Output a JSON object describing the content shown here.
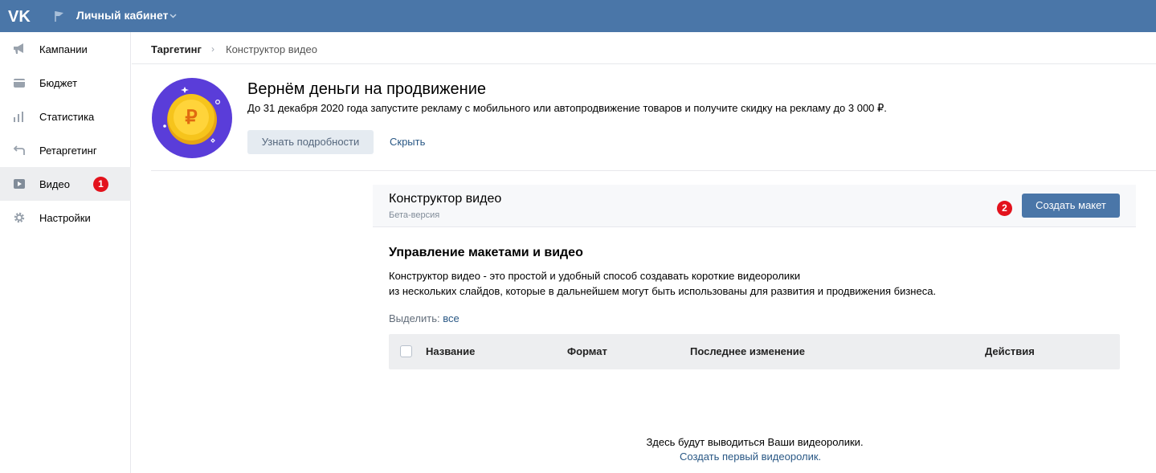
{
  "header": {
    "logo": "vk-logo",
    "title": "Личный кабинет"
  },
  "sidebar": {
    "items": [
      {
        "label": "Кампании",
        "icon": "megaphone-icon"
      },
      {
        "label": "Бюджет",
        "icon": "wallet-icon"
      },
      {
        "label": "Статистика",
        "icon": "bar-chart-icon"
      },
      {
        "label": "Ретаргетинг",
        "icon": "retarget-arrow-icon"
      },
      {
        "label": "Видео",
        "icon": "video-play-icon",
        "badge": "1",
        "active": true
      },
      {
        "label": "Настройки",
        "icon": "gear-icon"
      }
    ]
  },
  "breadcrumb": {
    "root": "Таргетинг",
    "separator": "›",
    "current": "Конструктор видео"
  },
  "promo": {
    "title": "Вернём деньги на продвижение",
    "text": "До 31 декабря 2020 года запустите рекламу с мобильного или автопродвижение товаров и получите скидку на рекламу до 3 000 ₽.",
    "details_button": "Узнать подробности",
    "hide_link": "Скрыть",
    "coin_symbol": "₽"
  },
  "panel": {
    "title": "Конструктор видео",
    "subtitle": "Бета-версия",
    "badge": "2",
    "create_button": "Создать макет"
  },
  "management": {
    "title": "Управление макетами и видео",
    "description_line1": "Конструктор видео - это простой и удобный способ создавать короткие видеоролики",
    "description_line2": "из нескольких слайдов, которые в дальнейшем могут быть использованы для развития и продвижения бизнеса.",
    "select_label": "Выделить:",
    "select_all": "все"
  },
  "table": {
    "columns": [
      "Название",
      "Формат",
      "Последнее изменение",
      "Действия"
    ]
  },
  "empty_state": {
    "text": "Здесь будут выводиться Ваши видеоролики.",
    "link": "Создать первый видеоролик."
  },
  "colors": {
    "brand": "#4a76a8",
    "badge": "#e3121c",
    "link": "#2a5885",
    "coin_bg": "#5a3dd9",
    "coin": "#f6c41c"
  }
}
